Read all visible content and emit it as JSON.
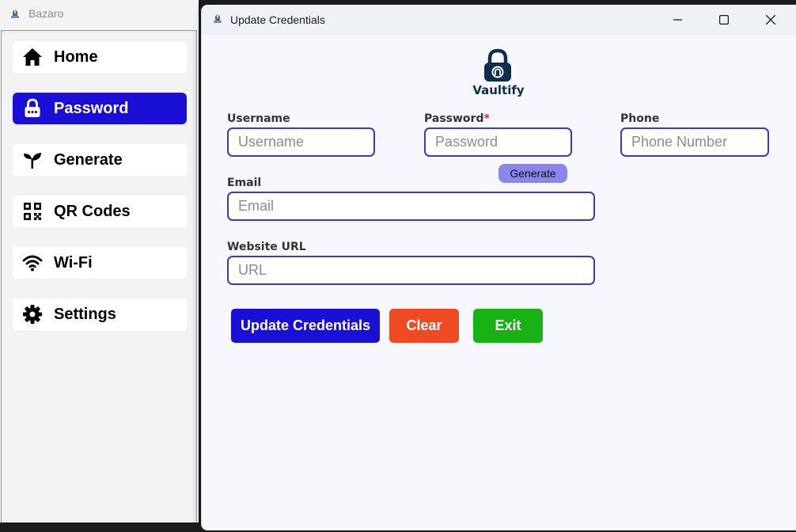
{
  "main_window": {
    "title": "Bazaro",
    "sidebar": {
      "items": [
        {
          "label": "Home",
          "icon": "home-icon",
          "active": false
        },
        {
          "label": "Password",
          "icon": "lock-icon",
          "active": true
        },
        {
          "label": "Generate",
          "icon": "sprout-icon",
          "active": false
        },
        {
          "label": "QR Codes",
          "icon": "qr-code-icon",
          "active": false
        },
        {
          "label": "Wi-Fi",
          "icon": "wifi-icon",
          "active": false
        },
        {
          "label": "Settings",
          "icon": "gear-icon",
          "active": false
        }
      ]
    }
  },
  "dialog": {
    "title": "Update Credentials",
    "logo_text": "Vaultify",
    "fields": {
      "username": {
        "label": "Username",
        "placeholder": "Username",
        "value": ""
      },
      "password": {
        "label": "Password",
        "required_mark": "*",
        "placeholder": "Password",
        "value": ""
      },
      "phone": {
        "label": "Phone",
        "placeholder": "Phone Number",
        "value": ""
      },
      "email": {
        "label": "Email",
        "placeholder": "Email",
        "value": ""
      },
      "website": {
        "label": "Website URL",
        "placeholder": "URL",
        "value": ""
      }
    },
    "generate_label": "Generate",
    "buttons": {
      "update": "Update Credentials",
      "clear": "Clear",
      "exit": "Exit"
    }
  },
  "colors": {
    "accent": "#1a0fd6",
    "input_border": "#3f35c9",
    "generate_bg": "#8a87ea",
    "update_bg": "#1a0fd6",
    "clear_bg": "#f04a25",
    "exit_bg": "#18b214",
    "logo": "#0f2c4a"
  }
}
